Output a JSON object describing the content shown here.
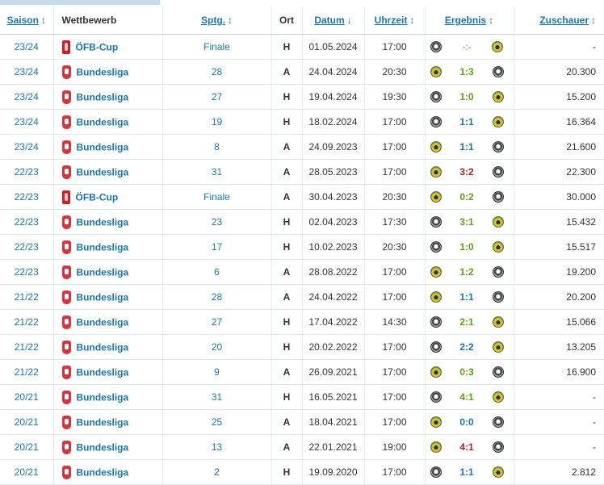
{
  "headers": {
    "season": "Saison",
    "competition": "Wettbewerb",
    "matchday": "Sptg.",
    "venue": "Ort",
    "date": "Datum",
    "time": "Uhrzeit",
    "result": "Ergebnis",
    "attendance": "Zuschauer"
  },
  "sort_icons": {
    "updown": "↕",
    "down": "↓"
  },
  "colors": {
    "accent": "#1d75a3",
    "win": "#5e9e1e",
    "draw": "#1d75a3",
    "loss": "#b01f24"
  },
  "rows": [
    {
      "season": "23/24",
      "comp": "ÖFB-Cup",
      "comp_icon": "cup-icon",
      "round": "Finale",
      "venue": "H",
      "date": "01.05.2024",
      "time": "17:00",
      "home_crest": "crest-a",
      "away_crest": "crest-b",
      "score": "-:-",
      "outcome": "none",
      "att": "-"
    },
    {
      "season": "23/24",
      "comp": "Bundesliga",
      "comp_icon": "league-icon",
      "round": "28",
      "venue": "A",
      "date": "24.04.2024",
      "time": "20:30",
      "home_crest": "crest-b",
      "away_crest": "crest-a",
      "score": "1:3",
      "outcome": "win",
      "att": "20.300"
    },
    {
      "season": "23/24",
      "comp": "Bundesliga",
      "comp_icon": "league-icon",
      "round": "27",
      "venue": "H",
      "date": "19.04.2024",
      "time": "19:30",
      "home_crest": "crest-a",
      "away_crest": "crest-b",
      "score": "1:0",
      "outcome": "win",
      "att": "15.200"
    },
    {
      "season": "23/24",
      "comp": "Bundesliga",
      "comp_icon": "league-icon",
      "round": "19",
      "venue": "H",
      "date": "18.02.2024",
      "time": "17:00",
      "home_crest": "crest-a",
      "away_crest": "crest-b",
      "score": "1:1",
      "outcome": "draw",
      "att": "16.364"
    },
    {
      "season": "23/24",
      "comp": "Bundesliga",
      "comp_icon": "league-icon",
      "round": "8",
      "venue": "A",
      "date": "24.09.2023",
      "time": "17:00",
      "home_crest": "crest-b",
      "away_crest": "crest-a",
      "score": "1:1",
      "outcome": "draw",
      "att": "21.600"
    },
    {
      "season": "22/23",
      "comp": "Bundesliga",
      "comp_icon": "league-icon",
      "round": "31",
      "venue": "A",
      "date": "28.05.2023",
      "time": "17:00",
      "home_crest": "crest-b",
      "away_crest": "crest-a",
      "score": "3:2",
      "outcome": "loss",
      "att": "22.300"
    },
    {
      "season": "22/23",
      "comp": "ÖFB-Cup",
      "comp_icon": "cup-icon",
      "round": "Finale",
      "venue": "A",
      "date": "30.04.2023",
      "time": "20:30",
      "home_crest": "crest-b",
      "away_crest": "crest-a",
      "score": "0:2",
      "outcome": "win",
      "att": "30.000"
    },
    {
      "season": "22/23",
      "comp": "Bundesliga",
      "comp_icon": "league-icon",
      "round": "23",
      "venue": "H",
      "date": "02.04.2023",
      "time": "17:30",
      "home_crest": "crest-a",
      "away_crest": "crest-b",
      "score": "3:1",
      "outcome": "win",
      "att": "15.432"
    },
    {
      "season": "22/23",
      "comp": "Bundesliga",
      "comp_icon": "league-icon",
      "round": "17",
      "venue": "H",
      "date": "10.02.2023",
      "time": "20:30",
      "home_crest": "crest-a",
      "away_crest": "crest-b",
      "score": "1:0",
      "outcome": "win",
      "att": "15.517"
    },
    {
      "season": "22/23",
      "comp": "Bundesliga",
      "comp_icon": "league-icon",
      "round": "6",
      "venue": "A",
      "date": "28.08.2022",
      "time": "17:00",
      "home_crest": "crest-b",
      "away_crest": "crest-a",
      "score": "1:2",
      "outcome": "win",
      "att": "19.200"
    },
    {
      "season": "21/22",
      "comp": "Bundesliga",
      "comp_icon": "league-icon",
      "round": "28",
      "venue": "A",
      "date": "24.04.2022",
      "time": "17:00",
      "home_crest": "crest-b",
      "away_crest": "crest-a",
      "score": "1:1",
      "outcome": "draw",
      "att": "20.200"
    },
    {
      "season": "21/22",
      "comp": "Bundesliga",
      "comp_icon": "league-icon",
      "round": "27",
      "venue": "H",
      "date": "17.04.2022",
      "time": "14:30",
      "home_crest": "crest-a",
      "away_crest": "crest-b",
      "score": "2:1",
      "outcome": "win",
      "att": "15.066"
    },
    {
      "season": "21/22",
      "comp": "Bundesliga",
      "comp_icon": "league-icon",
      "round": "20",
      "venue": "H",
      "date": "20.02.2022",
      "time": "17:00",
      "home_crest": "crest-a",
      "away_crest": "crest-b",
      "score": "2:2",
      "outcome": "draw",
      "att": "13.205"
    },
    {
      "season": "21/22",
      "comp": "Bundesliga",
      "comp_icon": "league-icon",
      "round": "9",
      "venue": "A",
      "date": "26.09.2021",
      "time": "17:00",
      "home_crest": "crest-b",
      "away_crest": "crest-a",
      "score": "0:3",
      "outcome": "win",
      "att": "16.900"
    },
    {
      "season": "20/21",
      "comp": "Bundesliga",
      "comp_icon": "league-icon",
      "round": "31",
      "venue": "H",
      "date": "16.05.2021",
      "time": "17:00",
      "home_crest": "crest-a",
      "away_crest": "crest-b",
      "score": "4:1",
      "outcome": "win",
      "att": "-"
    },
    {
      "season": "20/21",
      "comp": "Bundesliga",
      "comp_icon": "league-icon",
      "round": "25",
      "venue": "A",
      "date": "18.04.2021",
      "time": "17:00",
      "home_crest": "crest-b",
      "away_crest": "crest-a",
      "score": "0:0",
      "outcome": "draw",
      "att": "-"
    },
    {
      "season": "20/21",
      "comp": "Bundesliga",
      "comp_icon": "league-icon",
      "round": "13",
      "venue": "A",
      "date": "22.01.2021",
      "time": "19:00",
      "home_crest": "crest-b",
      "away_crest": "crest-a",
      "score": "4:1",
      "outcome": "loss",
      "att": "-"
    },
    {
      "season": "20/21",
      "comp": "Bundesliga",
      "comp_icon": "league-icon",
      "round": "2",
      "venue": "H",
      "date": "19.09.2020",
      "time": "17:00",
      "home_crest": "crest-a",
      "away_crest": "crest-b",
      "score": "1:1",
      "outcome": "draw",
      "att": "2.812"
    }
  ]
}
